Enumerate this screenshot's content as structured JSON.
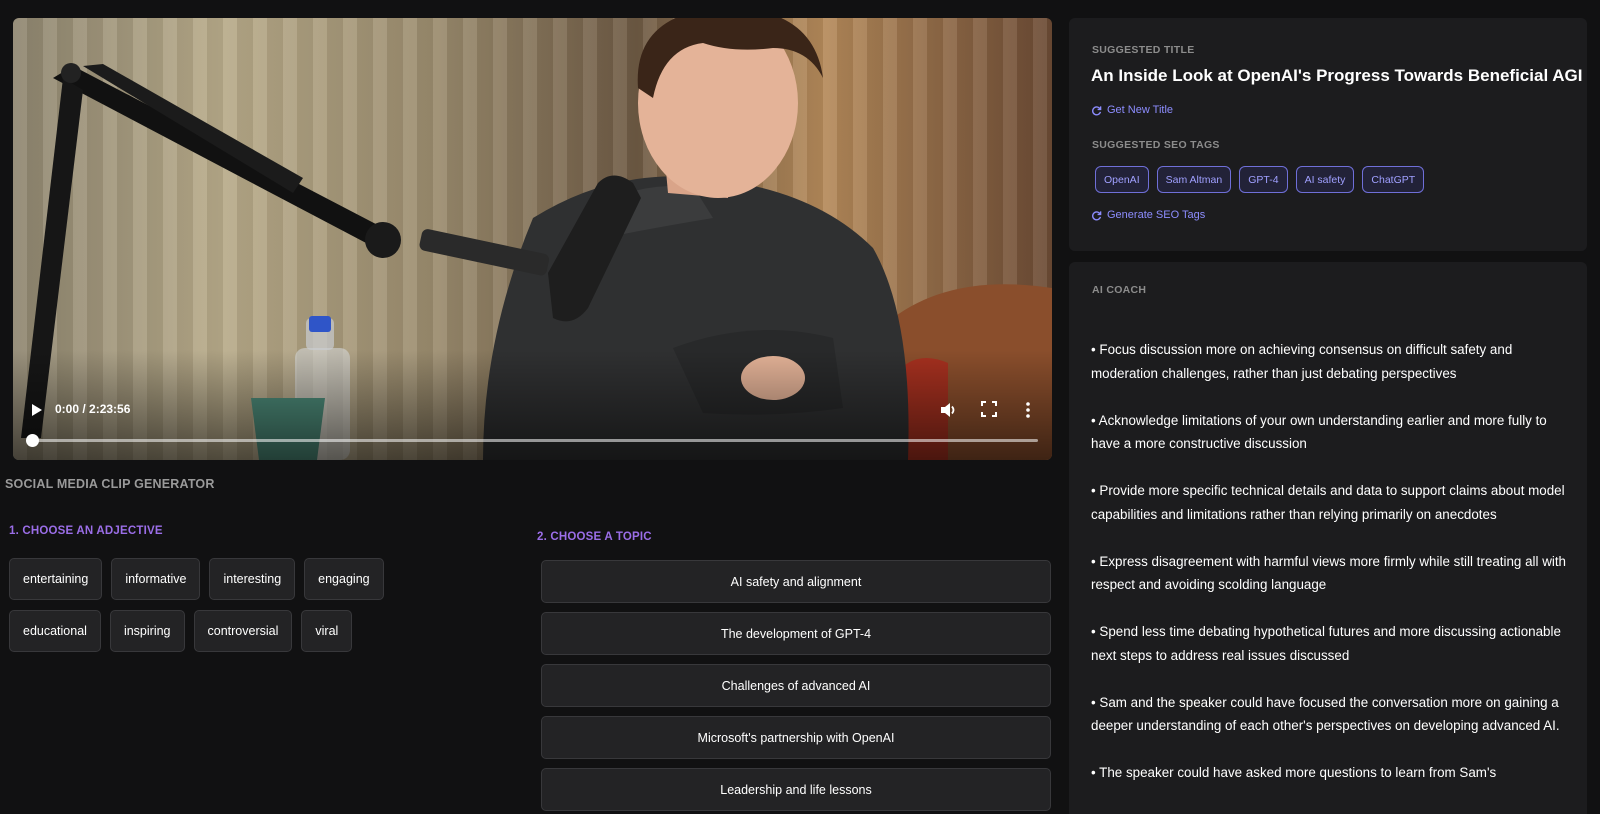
{
  "player": {
    "time": "0:00 / 2:23:56",
    "progress": 0
  },
  "clip_generator": {
    "title": "SOCIAL MEDIA CLIP GENERATOR",
    "step1_label": "1. CHOOSE AN ADJECTIVE",
    "step2_label": "2. CHOOSE A TOPIC",
    "adjectives": [
      "entertaining",
      "informative",
      "interesting",
      "engaging",
      "educational",
      "inspiring",
      "controversial",
      "viral"
    ],
    "topics": [
      "AI safety and alignment",
      "The development of GPT-4",
      "Challenges of advanced AI",
      "Microsoft's partnership with OpenAI",
      "Leadership and life lessons"
    ]
  },
  "suggestions": {
    "title_label": "SUGGESTED TITLE",
    "title": "An Inside Look at OpenAI's Progress Towards Beneficial AGI",
    "get_new_title": "Get New Title",
    "seo_label": "SUGGESTED SEO TAGS",
    "tags": [
      "OpenAI",
      "Sam Altman",
      "GPT-4",
      "AI safety",
      "ChatGPT"
    ],
    "generate_seo": "Generate SEO Tags"
  },
  "coach": {
    "label": "AI COACH",
    "items": [
      " • Focus discussion more on achieving consensus on difficult safety and moderation challenges, rather than just debating perspectives",
      "• Acknowledge limitations of your own understanding earlier and more fully to have a more constructive discussion",
      "• Provide more specific technical details and data to support claims about model capabilities and limitations rather than relying primarily on anecdotes",
      "• Express disagreement with harmful views more firmly while still treating all with respect and avoiding scolding language",
      "• Spend less time debating hypothetical futures and more discussing actionable next steps to address real issues discussed",
      "• Sam and the speaker could have focused the conversation more on gaining a deeper understanding of each other's perspectives on developing advanced AI.",
      "• The speaker could have asked more questions to learn from Sam's"
    ]
  },
  "colors": {
    "accent_purple": "#9b6ee8",
    "link_blue": "#8d8dff",
    "background": "#111112",
    "card": "#1c1c1e"
  }
}
